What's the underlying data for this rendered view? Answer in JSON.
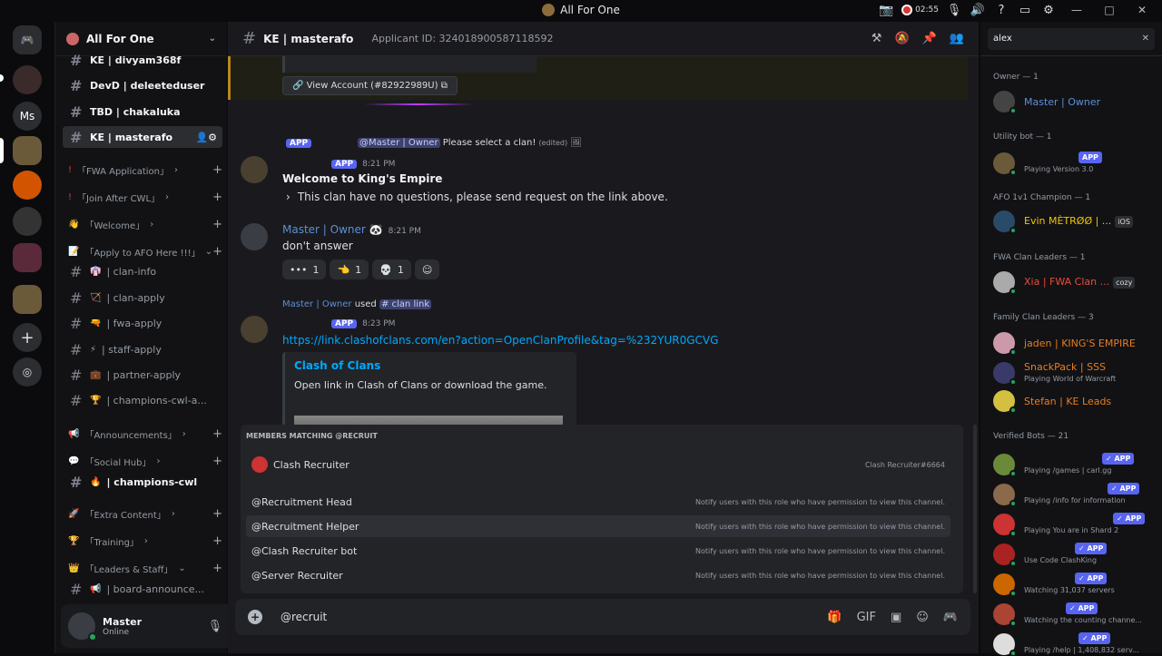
{
  "window": {
    "title": "All For One",
    "rec_time": "02:55"
  },
  "guilds": {
    "ms_label": "Ms"
  },
  "server": {
    "name": "All For One"
  },
  "channels": [
    {
      "label": "KE | divyam368f",
      "y": 0
    },
    {
      "label": "DevD | deleeteduser"
    },
    {
      "label": "TBD | chakaluka"
    },
    {
      "label": "KE | masterafo"
    }
  ],
  "categories": {
    "fwa_app": "「FWA Application」",
    "join_cwl": "「Join After CWL」",
    "welcome": "「Welcome」",
    "apply_afo": "「Apply to AFO Here !!!」",
    "announcements": "「Announcements」",
    "social": "「Social Hub」",
    "extra": "「Extra Content」",
    "training": "「Training」",
    "leaders": "「Leaders & Staff」"
  },
  "subchannels": {
    "clan_info": "| clan-info",
    "clan_apply": "| clan-apply",
    "fwa_apply": "| fwa-apply",
    "staff_apply": "| staff-apply",
    "partner_apply": "| partner-apply",
    "champions_cwl_a": "| champions-cwl-a...",
    "champions_cwl": "| champions-cwl",
    "board": "| board-announce..."
  },
  "user": {
    "name": "Master",
    "status": "Online"
  },
  "channel_header": {
    "name": "KE | masterafo",
    "topic": "Applicant ID: 324018900587118592"
  },
  "messages": {
    "view_account": "View Account (#82922989U)",
    "reply1_mention": "@Master | Owner",
    "reply1_text": "Please select a clan!",
    "reply1_edited": "(edited)",
    "app_label": "APP",
    "time1": "8:21 PM",
    "welcome_title": "Welcome to King's Empire",
    "welcome_line": "This clan have no questions, please send request on the link above.",
    "author2": "Master | Owner",
    "time2": "8:21 PM",
    "text2": "don't answer",
    "reactions": [
      "1",
      "1",
      "1"
    ],
    "reply3_author": "Master | Owner",
    "reply3_used": "used",
    "reply3_cmd": "# clan link",
    "time3": "8:23 PM",
    "link": "https://link.clashofclans.com/en?action=OpenClanProfile&tag=%232YUR0GCVG",
    "embed_title": "Clash of Clans",
    "embed_desc": "Open link in Clash of Clans or download the game."
  },
  "popup": {
    "header": "MEMBERS MATCHING @RECRUIT",
    "member_name": "Clash Recruiter",
    "member_tag": "Clash Recruiter#6664",
    "roles": [
      {
        "name": "@Recruitment Head",
        "hint": "Notify users with this role who have permission to view this channel."
      },
      {
        "name": "@Recruitment Helper",
        "hint": "Notify users with this role who have permission to view this channel."
      },
      {
        "name": "@Clash Recruiter bot",
        "hint": "Notify users with this role who have permission to view this channel."
      },
      {
        "name": "@Server Recruiter",
        "hint": "Notify users with this role who have permission to view this channel."
      }
    ]
  },
  "input": {
    "value": "@recruit"
  },
  "member_list": {
    "search": "alex",
    "sections": {
      "owner": "Owner — 1",
      "utility": "Utility bot — 1",
      "afo": "AFO 1v1 Champion — 1",
      "fwa": "FWA Clan Leaders — 1",
      "family": "Family Clan Leaders — 3",
      "verified": "Verified Bots — 21"
    },
    "owner": {
      "name": "Master | Owner"
    },
    "utility": {
      "activity": "Playing Version 3.0",
      "badge": "APP"
    },
    "afo": {
      "name": "Evin MÈTRØØ | ...",
      "tag": "iOS"
    },
    "fwa": {
      "name": "Xia | FWA Clan ...",
      "tag": "cozy"
    },
    "family": [
      {
        "name": "jaden | KING'S EMPIRE"
      },
      {
        "name": "SnackPack | SSS",
        "activity": "Playing World of Warcraft"
      },
      {
        "name": "Stefan | KE Leads"
      }
    ],
    "bots": [
      {
        "activity": "Playing /games | carl.gg"
      },
      {
        "activity": "Playing /info for information"
      },
      {
        "activity": "Playing You are in Shard 2"
      },
      {
        "activity": "Use Code ClashKing"
      },
      {
        "activity": "Watching 31,037 servers"
      },
      {
        "activity": "Watching the counting channe..."
      },
      {
        "activity": "Playing /help | 1,408,832 serv..."
      }
    ],
    "bot_badge": "✓ APP"
  },
  "colors": {
    "accent": "#5865f2",
    "link": "#00a8fc",
    "orange_name": "#e67e22",
    "gold_name": "#f1c40f",
    "red_name": "#e74c3c"
  }
}
